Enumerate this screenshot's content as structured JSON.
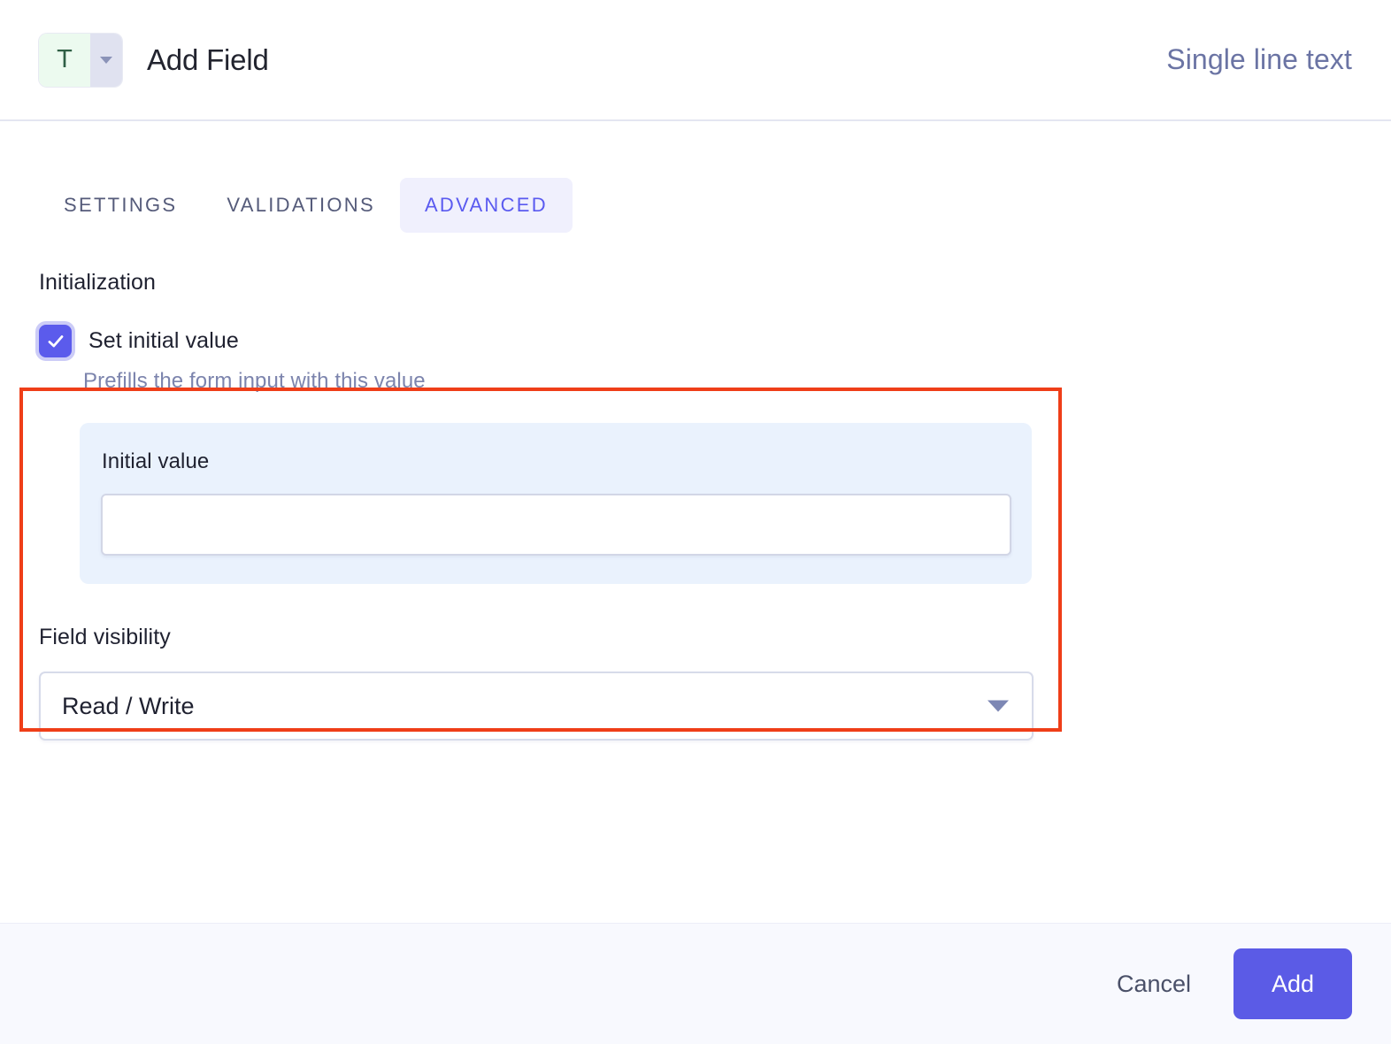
{
  "header": {
    "type_badge": {
      "glyph": "T",
      "caret_icon": "chevron-down-icon"
    },
    "title": "Add Field",
    "field_type": "Single line text"
  },
  "tabs": [
    {
      "label": "SETTINGS",
      "active": false
    },
    {
      "label": "VALIDATIONS",
      "active": false
    },
    {
      "label": "ADVANCED",
      "active": true
    }
  ],
  "advanced": {
    "section_title": "Initialization",
    "set_initial_value": {
      "label": "Set initial value",
      "checked": true,
      "help": "Prefills the form input with this value"
    },
    "initial_value": {
      "label": "Initial value",
      "value": "",
      "placeholder": ""
    },
    "field_visibility": {
      "label": "Field visibility",
      "selected": "Read / Write",
      "caret_icon": "chevron-down-icon"
    }
  },
  "footer": {
    "cancel_label": "Cancel",
    "add_label": "Add"
  },
  "colors": {
    "accent": "#5b5be6",
    "checkbox": "#5b5bec",
    "tab_active_text": "#5a5af0",
    "tab_active_bg": "#f0f0fd",
    "highlight_annotation": "#ef3e18",
    "panel_bg": "#eaf2fd",
    "muted_text": "#6b74a4",
    "badge_green_bg": "#ecfaef",
    "badge_green_text": "#2f5f45"
  }
}
